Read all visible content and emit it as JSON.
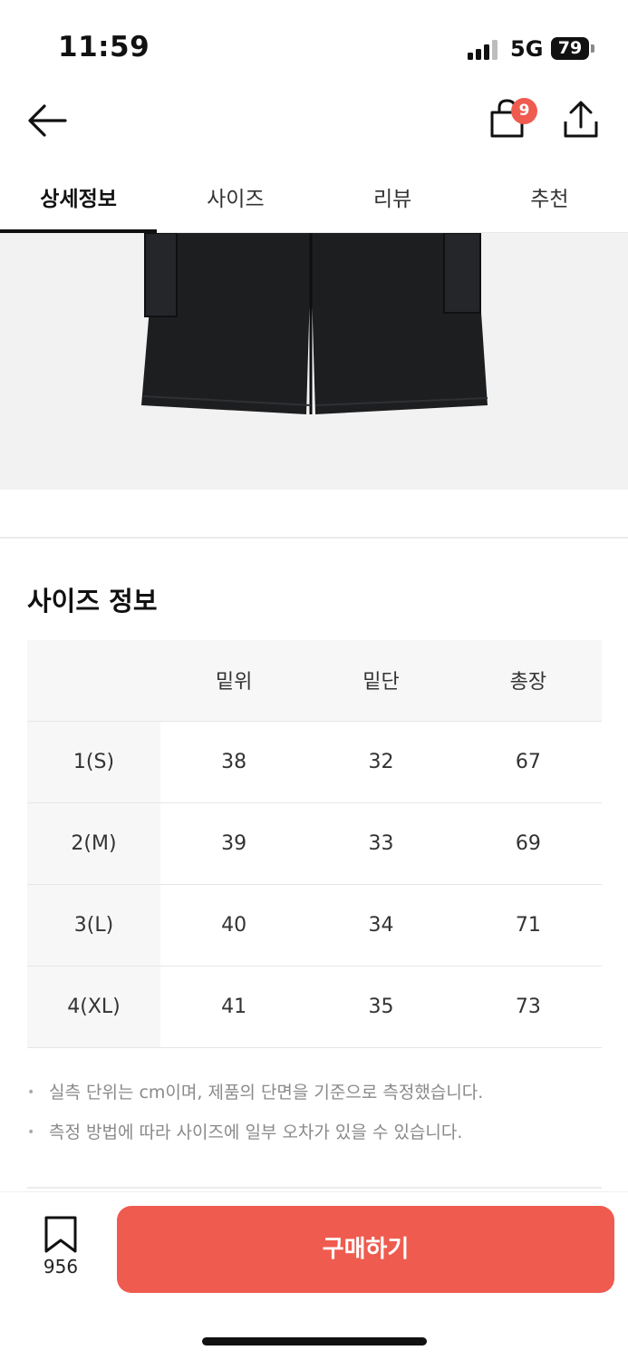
{
  "status_bar": {
    "time": "11:59",
    "network": "5G",
    "battery": "79"
  },
  "nav": {
    "back_icon": "arrow-left-icon",
    "cart_icon": "shopping-bag-icon",
    "cart_count": "9",
    "share_icon": "share-upload-icon"
  },
  "tabs": [
    {
      "label": "상세정보",
      "active": true
    },
    {
      "label": "사이즈",
      "active": false
    },
    {
      "label": "리뷰",
      "active": false
    },
    {
      "label": "추천",
      "active": false
    }
  ],
  "size_info": {
    "title": "사이즈 정보",
    "columns": [
      "",
      "밑위",
      "밑단",
      "총장"
    ],
    "rows": [
      {
        "size": "1(S)",
        "values": [
          "38",
          "32",
          "67"
        ]
      },
      {
        "size": "2(M)",
        "values": [
          "39",
          "33",
          "69"
        ]
      },
      {
        "size": "3(L)",
        "values": [
          "40",
          "34",
          "71"
        ]
      },
      {
        "size": "4(XL)",
        "values": [
          "41",
          "35",
          "73"
        ]
      }
    ],
    "notes": [
      "실측 단위는 cm이며, 제품의 단면을 기준으로 측정했습니다.",
      "측정 방법에 따라 사이즈에 일부 오차가 있을 수 있습니다."
    ]
  },
  "bottom_bar": {
    "bookmark_icon": "bookmark-icon",
    "bookmark_count": "956",
    "buy_label": "구매하기"
  },
  "colors": {
    "accent": "#ef5b4f",
    "product": "#1d1e20",
    "image_bg": "#f2f2f2"
  }
}
